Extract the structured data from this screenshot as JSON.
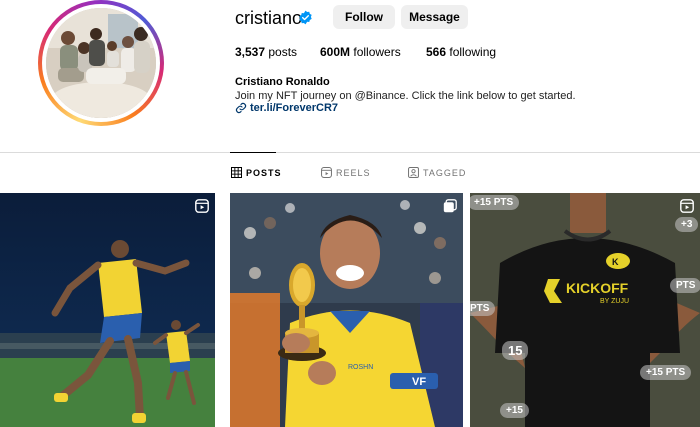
{
  "profile": {
    "username": "cristiano",
    "follow_label": "Follow",
    "message_label": "Message",
    "posts_count": "3,537",
    "posts_label": "posts",
    "followers_count": "600M",
    "followers_label": "followers",
    "following_count": "566",
    "following_label": "following",
    "full_name": "Cristiano Ronaldo",
    "bio": "Join my NFT journey on @Binance. Click the link below to get started.",
    "link": "ter.li/ForeverCR7"
  },
  "tabs": [
    {
      "label": "POSTS",
      "icon": "grid-icon",
      "active": true
    },
    {
      "label": "REELS",
      "icon": "reels-icon",
      "active": false
    },
    {
      "label": "TAGGED",
      "icon": "tagged-icon",
      "active": false
    }
  ],
  "posts": [
    {
      "type": "reel",
      "badge_icon": "reels-badge-icon"
    },
    {
      "type": "carousel",
      "badge_icon": "carousel-badge-icon",
      "shirt_text": "ROSHN",
      "sleeve_text": "VF"
    },
    {
      "type": "reel",
      "badge_icon": "reels-badge-icon",
      "brand": "KICKOFF",
      "brand_sub": "BY ZUJU",
      "pts_badges": [
        "+15 PTS",
        "+3",
        "PTS",
        "15",
        "+15 PTS",
        "+15",
        "PTS"
      ]
    }
  ],
  "colors": {
    "verified": "#0095f6",
    "button_bg": "#efefef",
    "link": "#00376b",
    "divider": "#dbdbdb",
    "kit_yellow": "#f5d632",
    "kit_blue": "#2a5fae"
  }
}
